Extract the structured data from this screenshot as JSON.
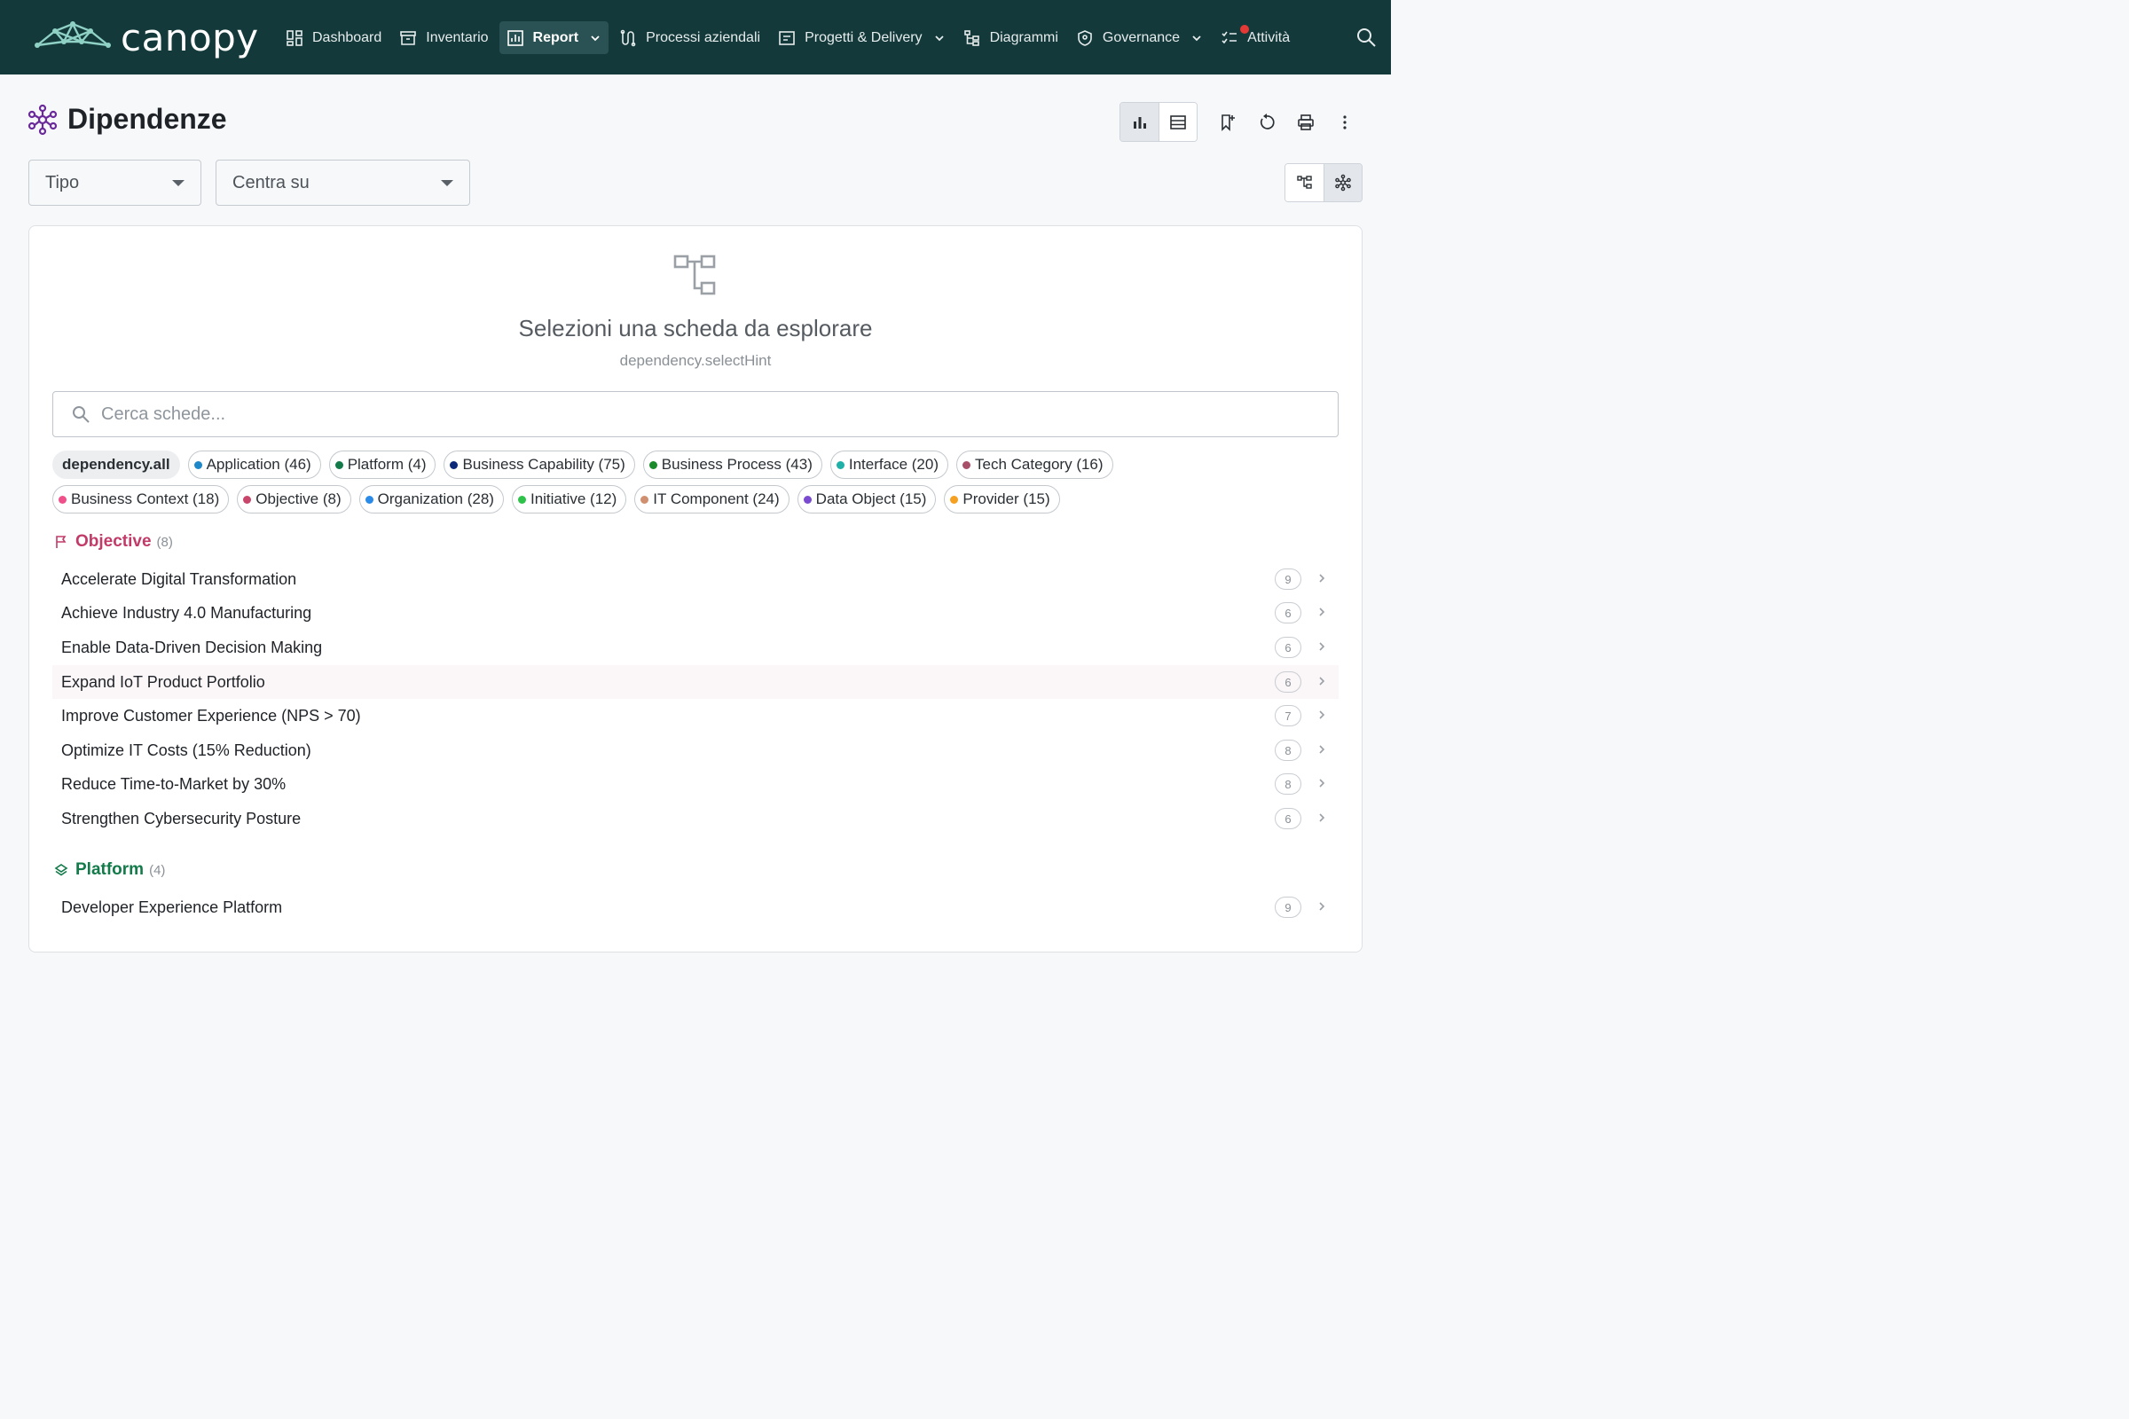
{
  "app": {
    "logo_text": "canopy"
  },
  "nav": {
    "items": [
      {
        "label": "Dashboard"
      },
      {
        "label": "Inventario"
      },
      {
        "label": "Report"
      },
      {
        "label": "Processi aziendali"
      },
      {
        "label": "Progetti & Delivery"
      },
      {
        "label": "Diagrammi"
      },
      {
        "label": "Governance"
      },
      {
        "label": "Attività"
      }
    ]
  },
  "page": {
    "title": "Dipendenze"
  },
  "filters": {
    "type_label": "Tipo",
    "center_label": "Centra su"
  },
  "empty_state": {
    "title": "Selezioni una scheda da esplorare",
    "hint": "dependency.selectHint"
  },
  "search": {
    "placeholder": "Cerca schede..."
  },
  "chips": {
    "all_label": "dependency.all",
    "row1": [
      {
        "label": "Application (46)",
        "color": "#1e88c8"
      },
      {
        "label": "Platform (4)",
        "color": "#137a4a"
      },
      {
        "label": "Business Capability (75)",
        "color": "#0d2a7a"
      },
      {
        "label": "Business Process (43)",
        "color": "#1a8a2a"
      },
      {
        "label": "Interface (20)",
        "color": "#1fb0a8"
      },
      {
        "label": "Tech Category (16)",
        "color": "#a8506a"
      }
    ],
    "row2": [
      {
        "label": "Business Context (18)",
        "color": "#f0508a"
      },
      {
        "label": "Objective (8)",
        "color": "#c8466a"
      },
      {
        "label": "Organization (28)",
        "color": "#2a8ae8"
      },
      {
        "label": "Initiative (12)",
        "color": "#2ec24a"
      },
      {
        "label": "IT Component (24)",
        "color": "#d09070"
      },
      {
        "label": "Data Object (15)",
        "color": "#7a4ad0"
      },
      {
        "label": "Provider (15)",
        "color": "#f5a020"
      }
    ]
  },
  "groups": {
    "objective": {
      "label": "Objective",
      "count": "(8)",
      "color": "#c23b68",
      "items": [
        {
          "label": "Accelerate Digital Transformation",
          "count": "9"
        },
        {
          "label": "Achieve Industry 4.0 Manufacturing",
          "count": "6"
        },
        {
          "label": "Enable Data-Driven Decision Making",
          "count": "6"
        },
        {
          "label": "Expand IoT Product Portfolio",
          "count": "6"
        },
        {
          "label": "Improve Customer Experience (NPS > 70)",
          "count": "7"
        },
        {
          "label": "Optimize IT Costs (15% Reduction)",
          "count": "8"
        },
        {
          "label": "Reduce Time-to-Market by 30%",
          "count": "8"
        },
        {
          "label": "Strengthen Cybersecurity Posture",
          "count": "6"
        }
      ]
    },
    "platform": {
      "label": "Platform",
      "count": "(4)",
      "color": "#137a4a",
      "items": [
        {
          "label": "Developer Experience Platform",
          "count": "9"
        }
      ]
    }
  }
}
